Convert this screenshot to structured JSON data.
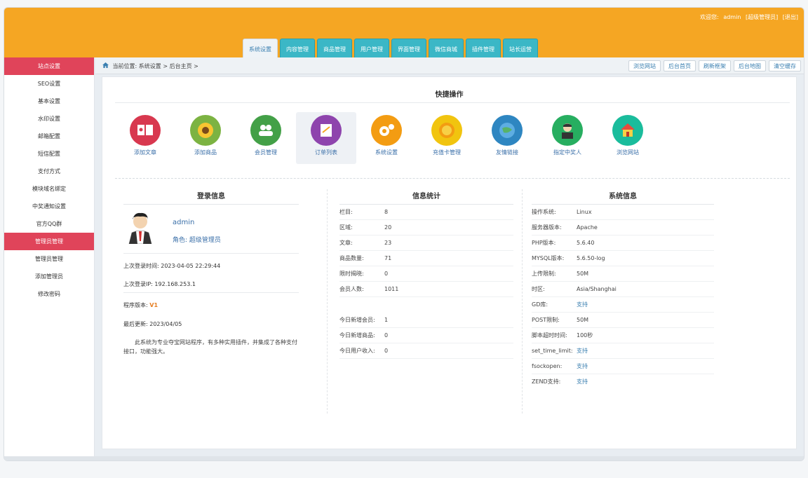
{
  "header": {
    "welcome_prefix": "欢迎您:",
    "user": "admin",
    "role_tag": "[超级管理员]",
    "logout": "[退出]"
  },
  "nav": {
    "tabs": [
      "系统设置",
      "内容管理",
      "商品管理",
      "用户管理",
      "界面管理",
      "微信商城",
      "插件管理",
      "站长运营"
    ]
  },
  "sidebar": {
    "items": [
      {
        "label": "站点设置",
        "active": true
      },
      {
        "label": "SEO设置"
      },
      {
        "label": "基本设置"
      },
      {
        "label": "水印设置"
      },
      {
        "label": "邮箱配置"
      },
      {
        "label": "短信配置"
      },
      {
        "label": "支付方式"
      },
      {
        "label": "模块域名绑定"
      },
      {
        "label": "中奖通知设置"
      },
      {
        "label": "官方QQ群"
      },
      {
        "label": "管理员管理",
        "active": true
      },
      {
        "label": "管理员管理"
      },
      {
        "label": "添加管理员"
      },
      {
        "label": "修改密码"
      }
    ]
  },
  "breadcrumb": {
    "text": "当前位置: 系统设置 > 后台主页 >",
    "actions": [
      "浏览网站",
      "后台首页",
      "刷新框架",
      "后台地图",
      "清空缓存"
    ]
  },
  "quick_actions": {
    "title": "快捷操作",
    "items": [
      {
        "label": "添加文章",
        "icon": "book-icon",
        "color": "#d8384f"
      },
      {
        "label": "添加商品",
        "icon": "sunflower-icon",
        "color": "#7cb342"
      },
      {
        "label": "会员管理",
        "icon": "users-icon",
        "color": "#43a047"
      },
      {
        "label": "订单列表",
        "icon": "order-list-icon",
        "color": "#8e44ad"
      },
      {
        "label": "系统设置",
        "icon": "gears-icon",
        "color": "#f39c12"
      },
      {
        "label": "充值卡管理",
        "icon": "coin-icon",
        "color": "#f1c40f"
      },
      {
        "label": "友情链接",
        "icon": "globe-link-icon",
        "color": "#2e86c1"
      },
      {
        "label": "指定中奖人",
        "icon": "person-icon",
        "color": "#27ae60"
      },
      {
        "label": "浏览网站",
        "icon": "house-icon",
        "color": "#1abc9c"
      }
    ]
  },
  "login_info": {
    "title": "登录信息",
    "username": "admin",
    "role": "角色: 超级管理员",
    "last_login_time": "上次登录时间: 2023-04-05 22:29:44",
    "last_login_ip": "上次登录IP: 192.168.253.1",
    "version_label": "程序版本:",
    "version": "V1",
    "updated": "最后更新: 2023/04/05",
    "description": "此系统为专业夺宝网站程序，有多种实用插件，并集成了各种支付接口，功能强大。"
  },
  "stats": {
    "title": "信息统计",
    "rows": [
      {
        "k": "栏目:",
        "v": "8"
      },
      {
        "k": "区域:",
        "v": "20"
      },
      {
        "k": "文章:",
        "v": "23"
      },
      {
        "k": "商品数量:",
        "v": "71"
      },
      {
        "k": "限时揭晓:",
        "v": "0"
      },
      {
        "k": "会员人数:",
        "v": "1011"
      }
    ],
    "rows2": [
      {
        "k": "今日新增会员:",
        "v": "1"
      },
      {
        "k": "今日新增商品:",
        "v": "0"
      },
      {
        "k": "今日用户收入:",
        "v": "0"
      }
    ]
  },
  "sysinfo": {
    "title": "系统信息",
    "rows": [
      {
        "k": "操作系统:",
        "v": "Linux"
      },
      {
        "k": "服务器版本:",
        "v": "Apache"
      },
      {
        "k": "PHP版本:",
        "v": "5.6.40"
      },
      {
        "k": "MYSQL版本:",
        "v": "5.6.50-log"
      },
      {
        "k": "上传限制:",
        "v": "50M"
      },
      {
        "k": "时区:",
        "v": "Asia/Shanghai"
      },
      {
        "k": "GD库:",
        "v": "支持",
        "link": true
      },
      {
        "k": "POST限制:",
        "v": "50M"
      },
      {
        "k": "脚本超时时间:",
        "v": "100秒"
      },
      {
        "k": "set_time_limit:",
        "v": "支持",
        "link": true
      },
      {
        "k": "fsockopen:",
        "v": "支持",
        "link": true
      },
      {
        "k": "ZEND支持:",
        "v": "支持",
        "link": true
      }
    ]
  }
}
